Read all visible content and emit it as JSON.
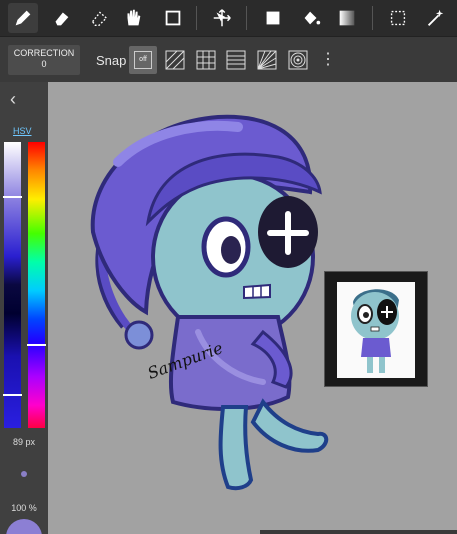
{
  "toolbar": {
    "tools": [
      {
        "name": "pen-icon",
        "active": true
      },
      {
        "name": "eraser-icon",
        "active": false
      },
      {
        "name": "blur-eraser-icon",
        "active": false
      },
      {
        "name": "hand-icon",
        "active": false
      },
      {
        "name": "rectangle-icon",
        "active": false
      },
      {
        "name": "move-icon",
        "active": false
      },
      {
        "name": "fill-rect-icon",
        "active": false
      },
      {
        "name": "bucket-icon",
        "active": false
      },
      {
        "name": "gradient-icon",
        "active": false
      },
      {
        "name": "select-icon",
        "active": false
      },
      {
        "name": "magic-wand-icon",
        "active": false
      }
    ]
  },
  "subbar": {
    "correction_label": "CORRECTION",
    "correction_value": "0",
    "snap_label": "Snap",
    "snap_off_label": "off",
    "snap_modes": [
      "parallel-snap-icon",
      "grid-snap-icon",
      "horizontal-snap-icon",
      "perspective-snap-icon",
      "concentric-snap-icon"
    ]
  },
  "leftpanel": {
    "collapse_glyph": "‹",
    "color_mode": "HSV",
    "brush_size": "89 px",
    "opacity": "100 %"
  },
  "canvas": {
    "watermark": "Sampurie"
  },
  "colors": {
    "toolbar_bg": "#2b2b2b",
    "panel_bg": "#404040",
    "accent_blue": "#6fc8ff",
    "canvas_bg": "#a2a2a2",
    "hood_purple": "#6b5bd0",
    "body_cyan": "#9fd3d8"
  }
}
